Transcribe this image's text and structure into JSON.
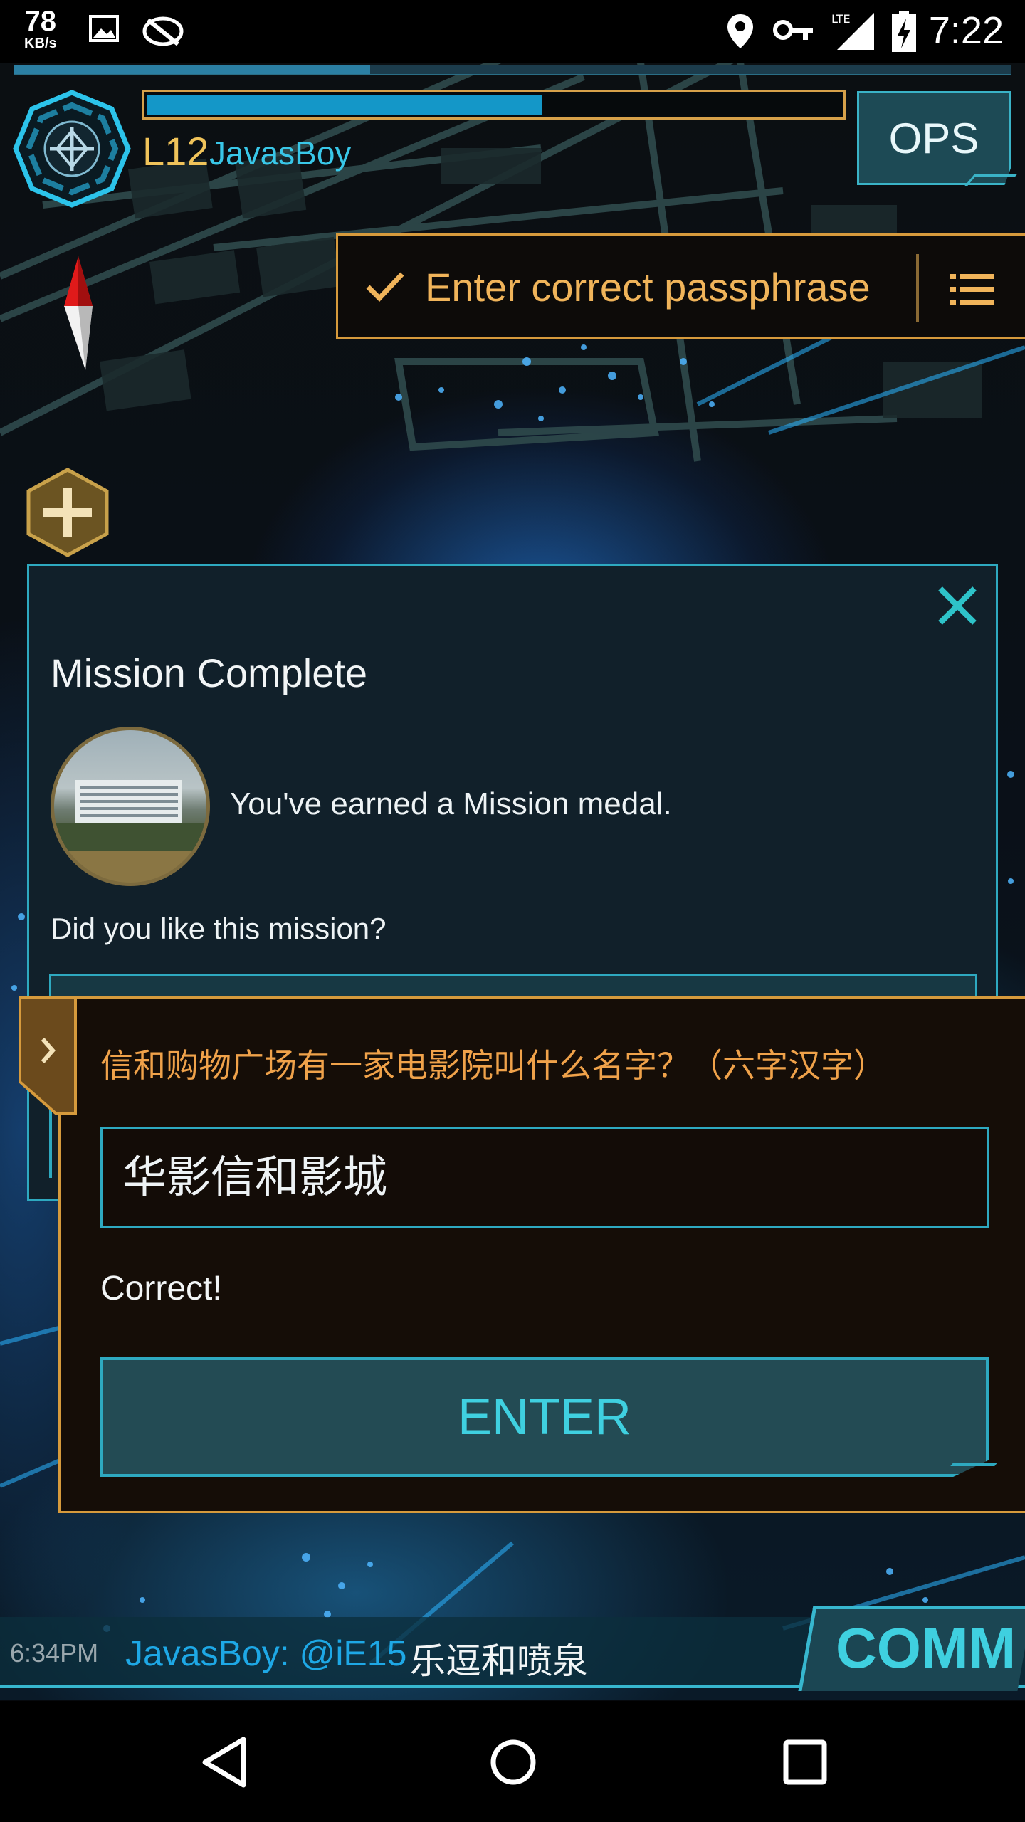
{
  "status_bar": {
    "net_speed_value": "78",
    "net_speed_unit": "KB/s",
    "network_label": "LTE",
    "time": "7:22"
  },
  "hud": {
    "level": "L12",
    "agent_name": "JavasBoy",
    "xp_progress": 0.57,
    "ops_label": "OPS"
  },
  "toast": {
    "text": "Enter correct passphrase"
  },
  "mission_dialog": {
    "title": "Mission Complete",
    "medal_text": "You've earned a Mission medal.",
    "question": "Did you like this mission?"
  },
  "passphrase_dialog": {
    "question": "信和购物广场有一家电影院叫什么名字？（六字汉字）",
    "answer": "华影信和影城",
    "result": "Correct!",
    "enter_label": "ENTER"
  },
  "comm": {
    "time": "6:34PM",
    "sender": "JavasBoy: @iE15",
    "message": "乐逗和喷泉",
    "button_label": "COMM"
  },
  "colors": {
    "accent_cyan": "#2ea9c0",
    "accent_orange": "#d69a3c",
    "xp_blue": "#1497c8",
    "level_gold": "#f0c35a"
  }
}
